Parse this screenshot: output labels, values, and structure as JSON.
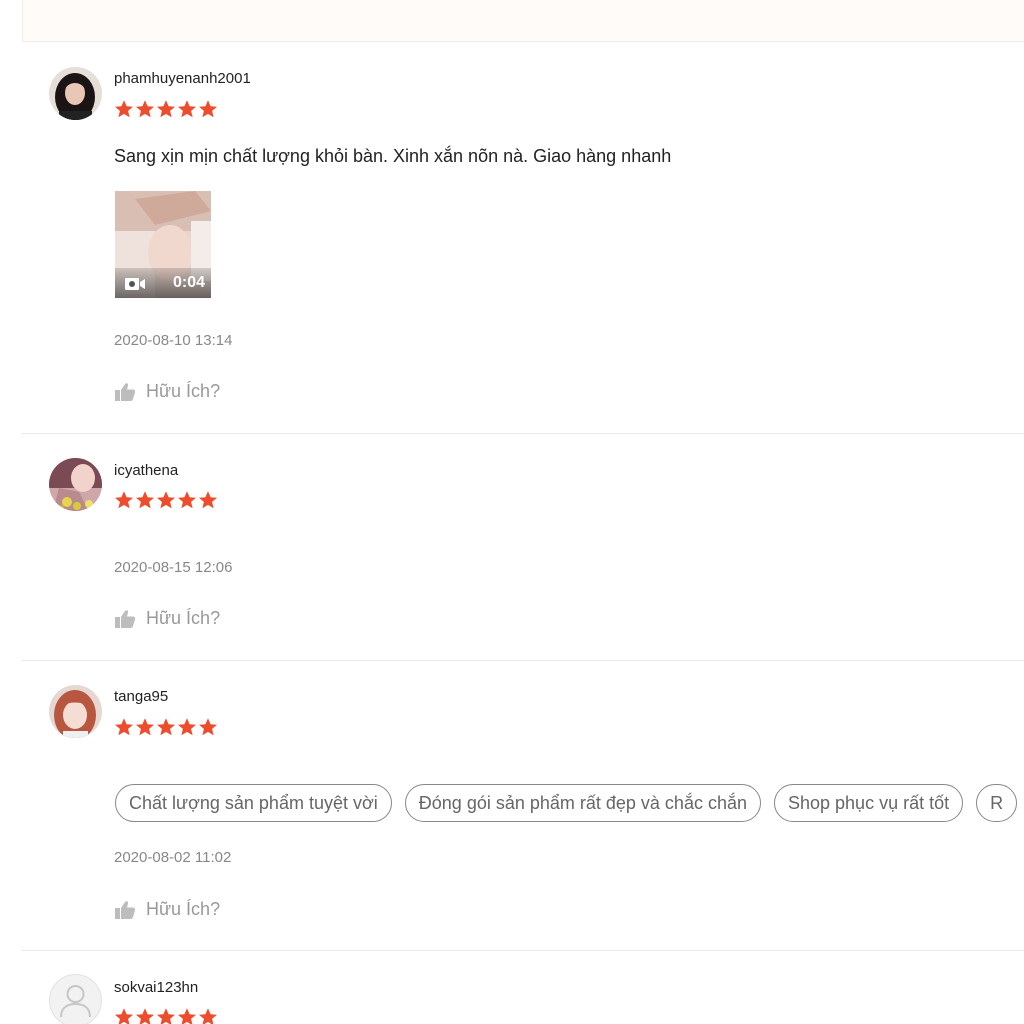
{
  "colors": {
    "star": "#ee4d2d",
    "text": "#222222",
    "muted": "#888888",
    "divider": "#e8e8e8"
  },
  "icons": {
    "rating": "star-icon",
    "helpful": "thumbs-up-icon",
    "video": "video-camera-icon",
    "default_avatar": "user-silhouette-icon"
  },
  "reviews": [
    {
      "username": "phamhuyenanh2001",
      "rating": 5,
      "comment": "Sang xịn mịn chất lượng khỏi bàn. Xinh xắn nõn nà. Giao hàng nhanh",
      "video_duration": "0:04",
      "timestamp": "2020-08-10 13:14",
      "helpful_label": "Hữu Ích?"
    },
    {
      "username": "icyathena",
      "rating": 5,
      "timestamp": "2020-08-15 12:06",
      "helpful_label": "Hữu Ích?"
    },
    {
      "username": "tanga95",
      "rating": 5,
      "tags": [
        "Chất lượng sản phẩm tuyệt vời",
        "Đóng gói sản phẩm rất đẹp và chắc chắn",
        "Shop phục vụ rất tốt",
        "R"
      ],
      "timestamp": "2020-08-02 11:02",
      "helpful_label": "Hữu Ích?"
    },
    {
      "username": "sokvai123hn",
      "rating": 5
    }
  ]
}
